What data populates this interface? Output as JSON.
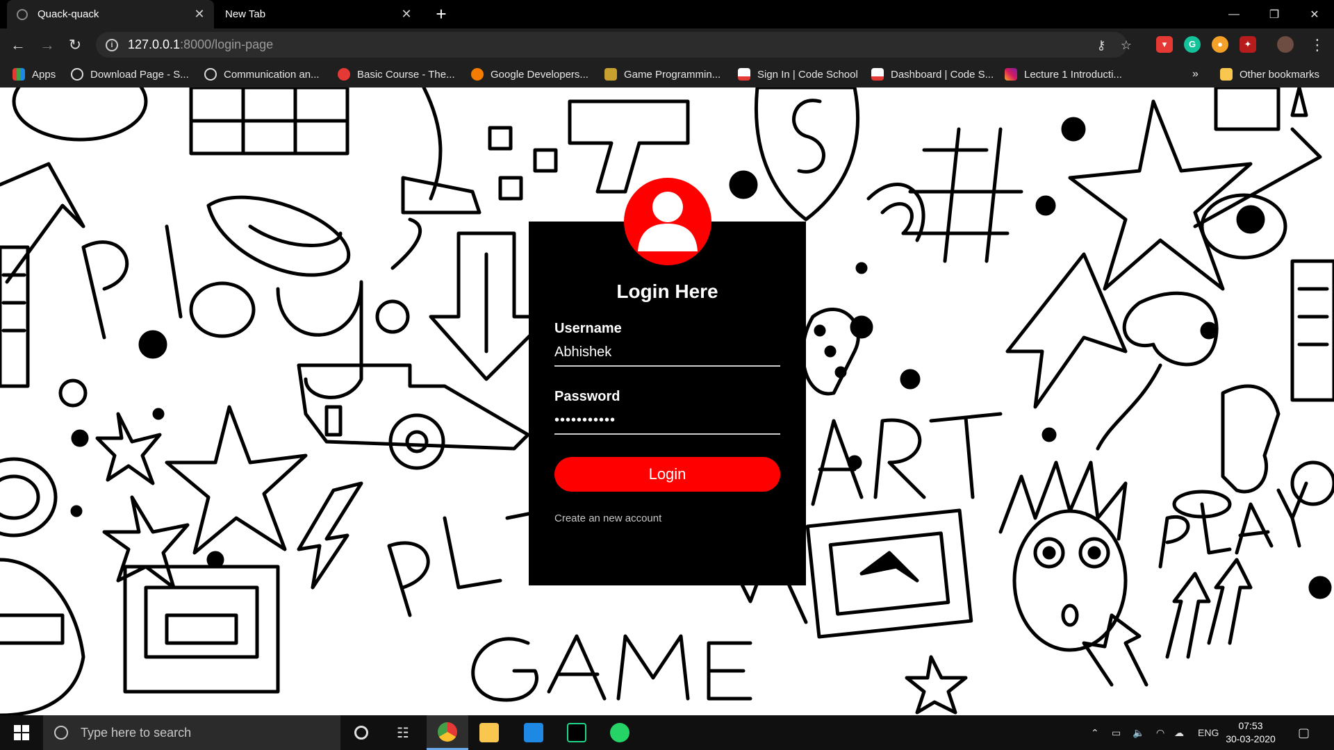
{
  "browser": {
    "tabs": [
      {
        "title": "Quack-quack",
        "active": true
      },
      {
        "title": "New Tab",
        "active": false
      }
    ],
    "new_tab_symbol": "+",
    "window_controls": {
      "minimize": "—",
      "restore": "❐",
      "close": "✕"
    },
    "url": {
      "host": "127.0.0.1",
      "path": ":8000/login-page"
    },
    "bookmarks": [
      {
        "label": "Apps",
        "icon": "apps-grid-icon"
      },
      {
        "label": "Download Page - S...",
        "icon": "globe-icon"
      },
      {
        "label": "Communication an...",
        "icon": "globe-icon"
      },
      {
        "label": "Basic Course - The...",
        "icon": "course-icon"
      },
      {
        "label": "Google Developers...",
        "icon": "google-dev-icon"
      },
      {
        "label": "Game Programmin...",
        "icon": "game-icon"
      },
      {
        "label": "Sign In | Code School",
        "icon": "gmail-icon"
      },
      {
        "label": "Dashboard | Code S...",
        "icon": "gmail-icon"
      },
      {
        "label": "Lecture 1 Introducti...",
        "icon": "instagram-icon"
      }
    ],
    "bookmarks_more": "»",
    "other_bookmarks": "Other bookmarks"
  },
  "login": {
    "title": "Login Here",
    "username_label": "Username",
    "username_value": "Abhishek",
    "password_label": "Password",
    "password_value": "•••••••••••",
    "button_label": "Login",
    "create_account_link": "Create an new account"
  },
  "taskbar": {
    "search_placeholder": "Type here to search",
    "language": "ENG",
    "time": "07:53",
    "date": "30-03-2020"
  },
  "colors": {
    "accent": "#ff0000",
    "card": "#000000",
    "chrome": "#1f1f1f"
  }
}
